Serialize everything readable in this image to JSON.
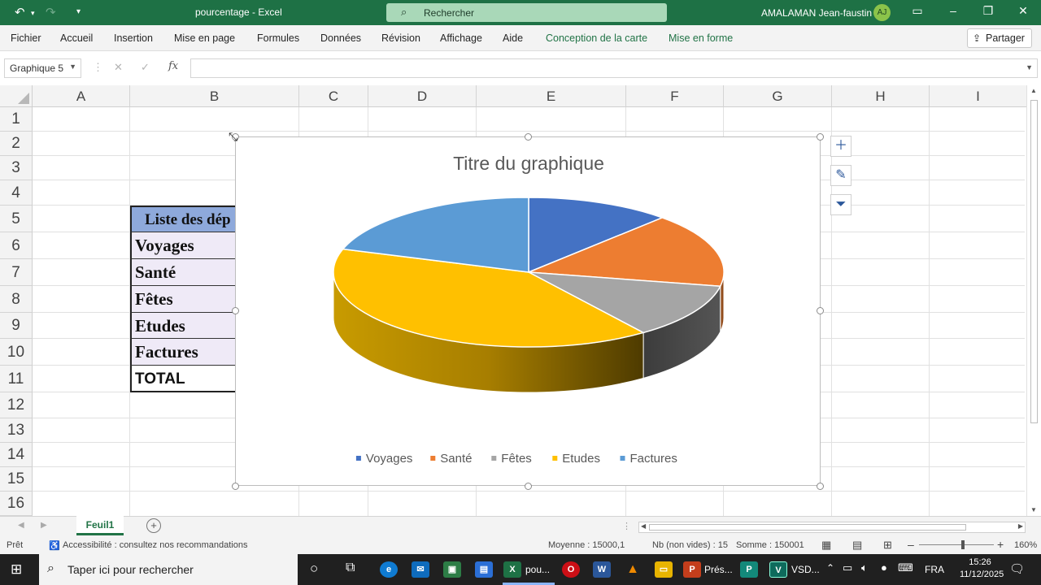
{
  "titlebar": {
    "doc_title": "pourcentage  -  Excel",
    "search_placeholder": "Rechercher",
    "user_name": "AMALAMAN Jean-faustin",
    "user_initials": "AJ"
  },
  "ribbon": {
    "tabs": [
      "Fichier",
      "Accueil",
      "Insertion",
      "Mise en page",
      "Formules",
      "Données",
      "Révision",
      "Affichage",
      "Aide"
    ],
    "context_tabs": [
      "Conception de la carte",
      "Mise en forme"
    ],
    "share_label": "Partager"
  },
  "formula_bar": {
    "name_box": "Graphique 5",
    "fx": "fx",
    "formula": ""
  },
  "columns": [
    "A",
    "B",
    "C",
    "D",
    "E",
    "F",
    "G",
    "H",
    "I"
  ],
  "rows": [
    "1",
    "2",
    "3",
    "4",
    "5",
    "6",
    "7",
    "8",
    "9",
    "10",
    "11",
    "12",
    "13",
    "14",
    "15",
    "16"
  ],
  "table": {
    "header": "Liste des dép",
    "items": [
      "Voyages",
      "Santé",
      "Fêtes",
      "Etudes",
      "Factures"
    ],
    "total": "TOTAL"
  },
  "chart_data": {
    "type": "pie",
    "title": "Titre du graphique",
    "categories": [
      "Voyages",
      "Santé",
      "Fêtes",
      "Etudes",
      "Factures"
    ],
    "values": [
      12,
      16,
      12,
      40,
      20
    ],
    "colors": [
      "#4472c4",
      "#ed7d31",
      "#a5a5a5",
      "#ffc000",
      "#5b9bd5"
    ],
    "legend_position": "bottom",
    "three_d": true
  },
  "sheet_tabs": {
    "active": "Feuil1"
  },
  "status": {
    "ready": "Prêt",
    "accessibility": "Accessibilité : consultez nos recommandations",
    "average": "Moyenne : 15000,1",
    "count": "Nb (non vides) : 15",
    "sum": "Somme : 150001",
    "zoom": "160%"
  },
  "taskbar": {
    "search_placeholder": "Taper ici pour rechercher",
    "excel_label": "pou...",
    "ppt_label": "Prés...",
    "vsd_label": "VSD...",
    "language": "FRA",
    "time": "15:26",
    "date": "11/12/2025"
  }
}
